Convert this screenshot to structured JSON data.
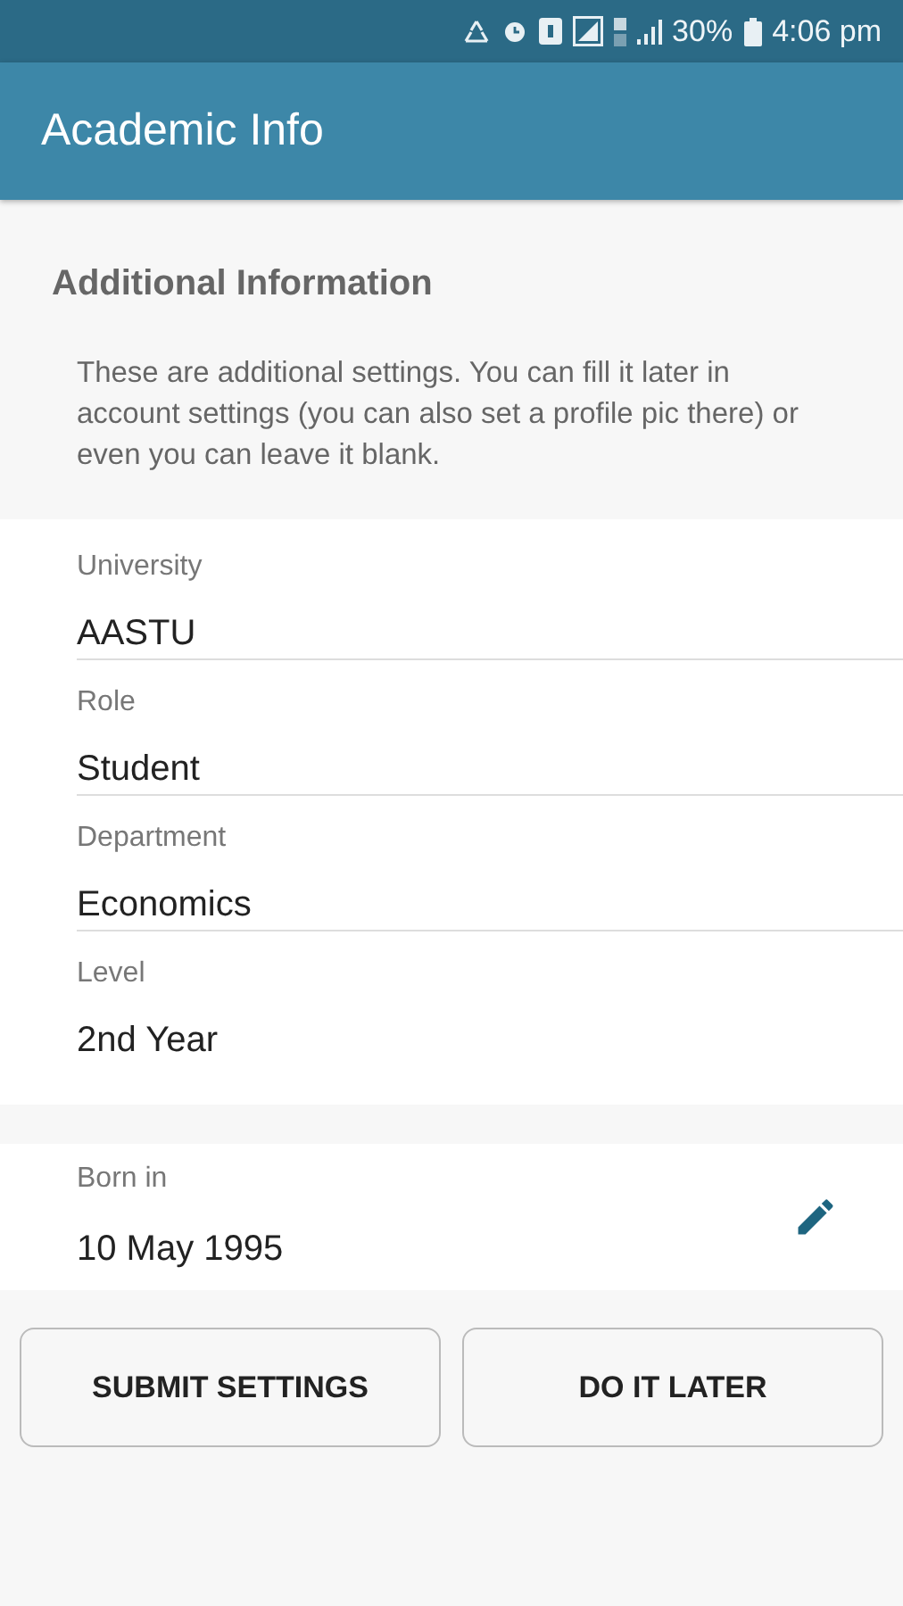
{
  "status_bar": {
    "battery": "30%",
    "time": "4:06 pm"
  },
  "app_bar": {
    "title": "Academic Info"
  },
  "intro": {
    "heading": "Additional Information",
    "text": "These are additional settings. You can fill it later in account settings (you can also set a profile pic there) or even you can leave it blank."
  },
  "fields": [
    {
      "label": "University",
      "value": "AASTU"
    },
    {
      "label": "Role",
      "value": "Student"
    },
    {
      "label": "Department",
      "value": "Economics"
    },
    {
      "label": "Level",
      "value": "2nd Year"
    }
  ],
  "birth": {
    "label": "Born in",
    "value": "10 May 1995"
  },
  "buttons": [
    "SUBMIT SETTINGS",
    "DO IT LATER"
  ]
}
